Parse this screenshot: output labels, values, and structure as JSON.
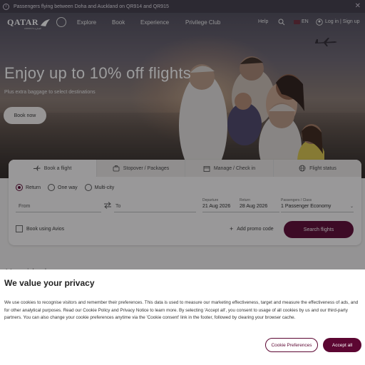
{
  "notice": {
    "text": "Passengers flying between Doha and Auckland on QR914 and QR915",
    "info_icon": "info-icon",
    "close_icon": "close-icon"
  },
  "nav": {
    "logo": "QATAR",
    "logo_sub": "AIRWAYS القطرية",
    "links": [
      "Explore",
      "Book",
      "Experience",
      "Privilege Club"
    ],
    "help": "Help",
    "language": "EN",
    "login": "Log in | Sign up"
  },
  "hero": {
    "title": "Enjoy up to 10% off flights",
    "subtitle": "Plus extra baggage to select destinations",
    "cta": "Book now"
  },
  "booking": {
    "tabs": [
      {
        "label": "Book a flight",
        "icon": "plane-icon"
      },
      {
        "label": "Stopover / Packages",
        "icon": "suitcase-icon"
      },
      {
        "label": "Manage / Check in",
        "icon": "calendar-icon"
      },
      {
        "label": "Flight status",
        "icon": "globe-icon"
      }
    ],
    "trip_types": [
      "Return",
      "One way",
      "Multi-city"
    ],
    "selected_trip": "Return",
    "from_label": "From",
    "to_label": "To",
    "departure_label": "Departure",
    "departure_value": "21 Aug 2026",
    "return_label": "Return",
    "return_value": "28 Aug 2026",
    "pax_label": "Passengers / Class",
    "pax_value": "1 Passenger Economy",
    "avios_label": "Book using Avios",
    "promo_label": "Add promo code",
    "search_label": "Search flights"
  },
  "section": {
    "title": "Your ideal escape"
  },
  "cookie": {
    "title": "We value your privacy",
    "text": "We use cookies to recognise visitors and remember their preferences. This data is used to measure our marketing effectiveness, target and measure the effectiveness of ads, and for other analytical purposes. Read our Cookie Policy and Privacy Notice to learn more. By selecting 'Accept all', you consent to usage of all cookies by us and our third-party partners. You can also change your cookie preferences anytime via the 'Cookie consent' link in the footer, followed by clearing your browser cache.",
    "preferences": "Cookie Preferences",
    "accept": "Accept all"
  },
  "colors": {
    "brand": "#5c0632",
    "notice_bg": "#3e3a48"
  }
}
